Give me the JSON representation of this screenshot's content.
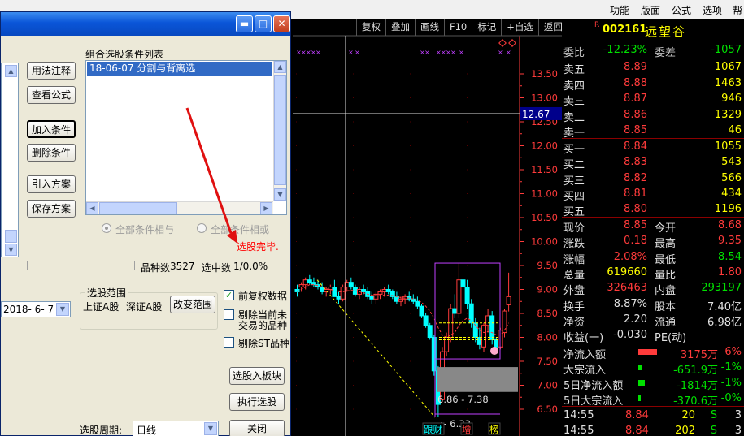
{
  "menubar": {
    "items": [
      "功能",
      "版面",
      "公式",
      "选项",
      "帮"
    ]
  },
  "chart": {
    "toolbar": [
      "复权",
      "叠加",
      "画线",
      "F10",
      "标记",
      "+自选",
      "返回"
    ],
    "price_ticks": [
      "13.50",
      "13.00",
      "12.50",
      "12.00",
      "11.50",
      "11.00",
      "10.50",
      "10.00",
      "9.50",
      "9.00",
      "8.50",
      "8.00",
      "7.50",
      "7.00",
      "6.50"
    ],
    "crosshair_price": "12.67",
    "low_marker": "6.33",
    "range_text": "6.86 - 7.38",
    "bottom_markers": [
      "跟财",
      "增",
      "榜"
    ],
    "colors": {
      "up": "#ff3b3b",
      "down": "#00ffff",
      "axis": "#ff3b3b",
      "box": "#c040ff"
    }
  },
  "quote": {
    "badge": "R",
    "code": "002161",
    "name": "远望谷",
    "weibi": {
      "label": "委比",
      "value": "-12.23%",
      "label2": "委差",
      "value2": "-1057"
    },
    "sell": [
      {
        "label": "卖五",
        "price": "8.89",
        "vol": "1067"
      },
      {
        "label": "卖四",
        "price": "8.88",
        "vol": "1463"
      },
      {
        "label": "卖三",
        "price": "8.87",
        "vol": "946"
      },
      {
        "label": "卖二",
        "price": "8.86",
        "vol": "1329"
      },
      {
        "label": "卖一",
        "price": "8.85",
        "vol": "46"
      }
    ],
    "buy": [
      {
        "label": "买一",
        "price": "8.84",
        "vol": "1055"
      },
      {
        "label": "买二",
        "price": "8.83",
        "vol": "543"
      },
      {
        "label": "买三",
        "price": "8.82",
        "vol": "566"
      },
      {
        "label": "买四",
        "price": "8.81",
        "vol": "434"
      },
      {
        "label": "买五",
        "price": "8.80",
        "vol": "1196"
      }
    ],
    "stats": [
      {
        "label": "现价",
        "value": "8.85",
        "label2": "今开",
        "value2": "8.68"
      },
      {
        "label": "涨跌",
        "value": "0.18",
        "label2": "最高",
        "value2": "9.35"
      },
      {
        "label": "涨幅",
        "value": "2.08%",
        "label2": "最低",
        "value2": "8.54"
      },
      {
        "label": "总量",
        "value": "619660",
        "label2": "量比",
        "value2": "1.80"
      },
      {
        "label": "外盘",
        "value": "326463",
        "label2": "内盘",
        "value2": "293197"
      }
    ],
    "stats2": [
      {
        "label": "换手",
        "value": "8.87%",
        "label2": "股本",
        "value2": "7.40亿"
      },
      {
        "label": "净资",
        "value": "2.20",
        "label2": "流通",
        "value2": "6.98亿"
      },
      {
        "label": "收益(一)",
        "value": "-0.030",
        "label2": "PE(动)",
        "value2": "—"
      }
    ],
    "flows": [
      {
        "label": "净流入额",
        "value": "3175万",
        "pct": "6%",
        "bar": 0.9
      },
      {
        "label": "大宗流入",
        "value": "-651.9万",
        "pct": "-1%",
        "bar": 0.15
      },
      {
        "label": "5日净流入额",
        "value": "-1814万",
        "pct": "-1%",
        "bar": 0.3
      },
      {
        "label": "5日大宗流入",
        "value": "-370.6万",
        "pct": "-0%",
        "bar": 0.1
      }
    ],
    "ticks": [
      {
        "time": "14:55",
        "price": "8.84",
        "vol": "20",
        "side": "S",
        "n": "3"
      },
      {
        "time": "14:55",
        "price": "8.84",
        "vol": "202",
        "side": "S",
        "n": "3"
      }
    ]
  },
  "dialog": {
    "buttons": {
      "usage": "用法注释",
      "view_formula": "查看公式",
      "add_cond": "加入条件",
      "del_cond": "删除条件",
      "import_plan": "引入方案",
      "save_plan": "保存方案",
      "change_range": "改变范围",
      "to_block": "选股入板块",
      "execute": "执行选股",
      "close": "关闭"
    },
    "list_title": "组合选股条件列表",
    "list_items": [
      "18-06-07 分割与背离选"
    ],
    "radio_and": "全部条件相与",
    "radio_or": "全部条件相或",
    "done_text": "选股完毕.",
    "count_label": "品种数",
    "count_value": "3527",
    "selected_label": "选中数",
    "selected_value": "1/0.0%",
    "range_group": "选股范围",
    "date_value": "2018- 6- 7",
    "range_items": [
      "上证A股",
      "深证A股"
    ],
    "chk_prev": "前复权数据",
    "chk_exclude_suspended": [
      "剔除当前未",
      "交易的品种"
    ],
    "chk_exclude_st": "剔除ST品种",
    "period_label": "选股周期:",
    "period_value": "日线"
  }
}
